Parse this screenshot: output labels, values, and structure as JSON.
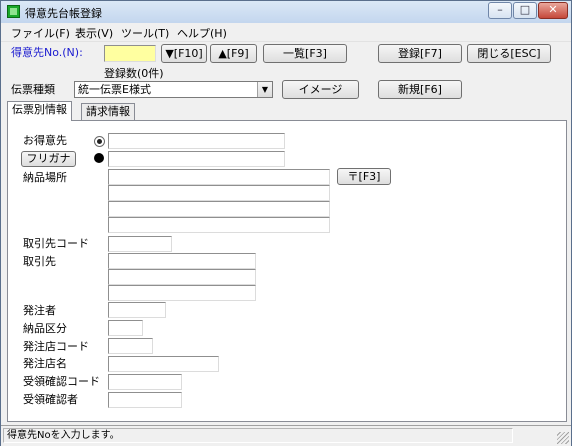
{
  "window": {
    "title": "得意先台帳登録",
    "controls": {
      "minimize": "–",
      "maximize": "□",
      "close": "✕"
    }
  },
  "menu": [
    "ファイル(F)",
    "表示(V)",
    "ツール(T)",
    "ヘルプ(H)"
  ],
  "toolbar": {
    "customer_no_label": "得意先No.(N):",
    "next_label": "▼[F10]",
    "prev_label": "▲[F9]",
    "list_label": "一覧[F3]",
    "register_label": "登録[F7]",
    "close_label": "閉じる[ESC]",
    "count_label": "登録数(0件)"
  },
  "slip": {
    "type_label": "伝票種類",
    "type_value": "統一伝票E様式",
    "image_label": "イメージ",
    "new_label": "新規[F6]"
  },
  "tabs": [
    "伝票別情報",
    "請求情報"
  ],
  "form": {
    "customer_label": "お得意先",
    "furigana_label": "フリガナ",
    "delivery_label": "納品場所",
    "postal_label": "〒[F3]",
    "partner_code_label": "取引先コード",
    "partner_label": "取引先",
    "orderer_label": "発注者",
    "delivery_type_label": "納品区分",
    "order_store_code_label": "発注店コード",
    "order_store_name_label": "発注店名",
    "receipt_code_label": "受領確認コード",
    "receipt_person_label": "受領確認者"
  },
  "status": {
    "message": "得意先Noを入力します。"
  }
}
